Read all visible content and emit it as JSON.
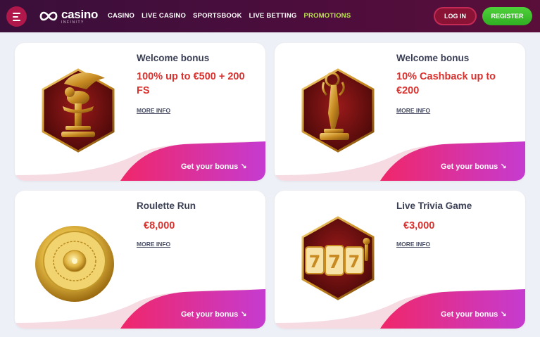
{
  "header": {
    "logo_word": "casino",
    "logo_sub": "INFINITY",
    "nav": [
      "CASINO",
      "LIVE CASINO",
      "SPORTSBOOK",
      "LIVE BETTING",
      "PROMOTIONS"
    ],
    "login": "LOG IN",
    "register": "REGISTER"
  },
  "cards": [
    {
      "title": "Welcome bonus",
      "offer": "100% up to €500 + 200 FS",
      "more": "MORE INFO",
      "cta": "Get your bonus ↘",
      "icon": "winged-lion-trophy-icon"
    },
    {
      "title": "Welcome bonus",
      "offer": "10% Cashback up to €200",
      "more": "MORE INFO",
      "cta": "Get your bonus ↘",
      "icon": "statuette-trophy-icon"
    },
    {
      "title": "Roulette Run",
      "offer": "€8,000",
      "more": "MORE INFO",
      "cta": "Get your bonus ↘",
      "icon": "roulette-wheel-icon"
    },
    {
      "title": "Live Trivia Game",
      "offer": "€3,000",
      "more": "MORE INFO",
      "cta": "Get your bonus ↘",
      "icon": "slot-reels-777-icon"
    }
  ],
  "colors": {
    "header_bg": "#4a0d3c",
    "promo_active": "#b9e64a",
    "offer_red": "#d8322f",
    "cta_gradient": [
      "#e8216a",
      "#c93ad0"
    ],
    "register_green": "#3bbf2a"
  }
}
